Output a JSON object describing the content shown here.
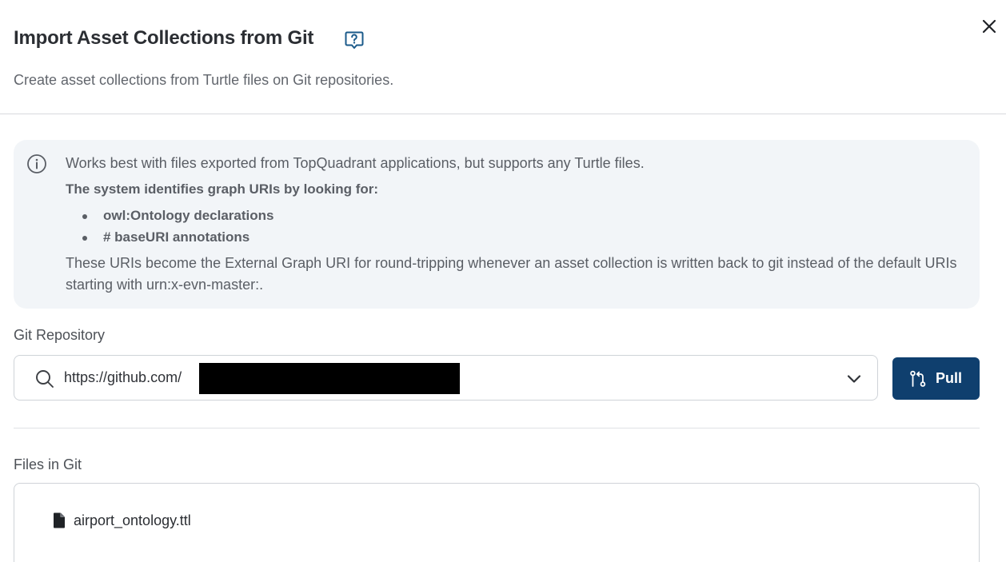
{
  "dialog": {
    "title": "Import Asset Collections from Git",
    "subtitle": "Create asset collections from Turtle files on Git repositories.",
    "help_icon": "help-chat-icon",
    "close_icon": "close-icon"
  },
  "info": {
    "icon": "info-icon",
    "line1": "Works best with files exported from TopQuadrant applications, but supports any Turtle files.",
    "heading": "The system identifies graph URIs by looking for:",
    "items": [
      "owl:Ontology declarations",
      "# baseURI annotations"
    ],
    "paragraph": "These URIs become the External Graph URI for round-tripping whenever an asset collection is written back to git instead of the default URIs starting with urn:x-evn-master:."
  },
  "repository": {
    "label": "Git Repository",
    "value": "https://github.com/",
    "search_icon": "search-icon",
    "dropdown_icon": "chevron-down-icon"
  },
  "pull_button": {
    "label": "Pull",
    "icon": "git-pull-request-icon"
  },
  "files": {
    "label": "Files in Git",
    "items": [
      {
        "name": "airport_ontology.ttl",
        "icon": "file-icon"
      }
    ]
  },
  "colors": {
    "primary": "#0f3f6e",
    "info_background": "#f2f5f8",
    "border": "#cfd3d8",
    "help_icon": "#1a5a8a"
  }
}
